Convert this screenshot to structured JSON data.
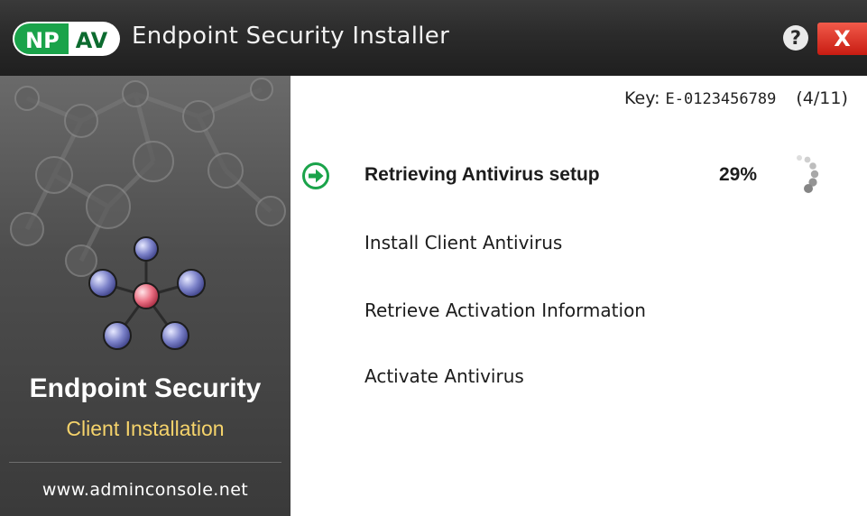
{
  "window": {
    "logo_left": "NP",
    "logo_right": "AV",
    "title": "Endpoint Security Installer",
    "help_glyph": "?",
    "close_glyph": "X"
  },
  "sidebar": {
    "heading": "Endpoint Security",
    "subheading": "Client Installation",
    "url": "www.adminconsole.net"
  },
  "install": {
    "key_label": "Key:",
    "key_value": "E-0123456789",
    "step_counter": "(4/11)",
    "steps": [
      {
        "label": "Retrieving Antivirus setup",
        "status": "active",
        "progress": "29%"
      },
      {
        "label": "Install Client Antivirus",
        "status": "pending"
      },
      {
        "label": "Retrieve Activation Information",
        "status": "pending"
      },
      {
        "label": "Activate Antivirus",
        "status": "pending"
      }
    ]
  },
  "colors": {
    "accent_green": "#1aa34a",
    "close_red": "#d9281c",
    "subheading_yellow": "#f5d36b"
  },
  "icons": {
    "active_step": "arrow-circle-right-icon",
    "loading": "spinner-icon",
    "help": "question-icon",
    "close": "close-icon"
  }
}
